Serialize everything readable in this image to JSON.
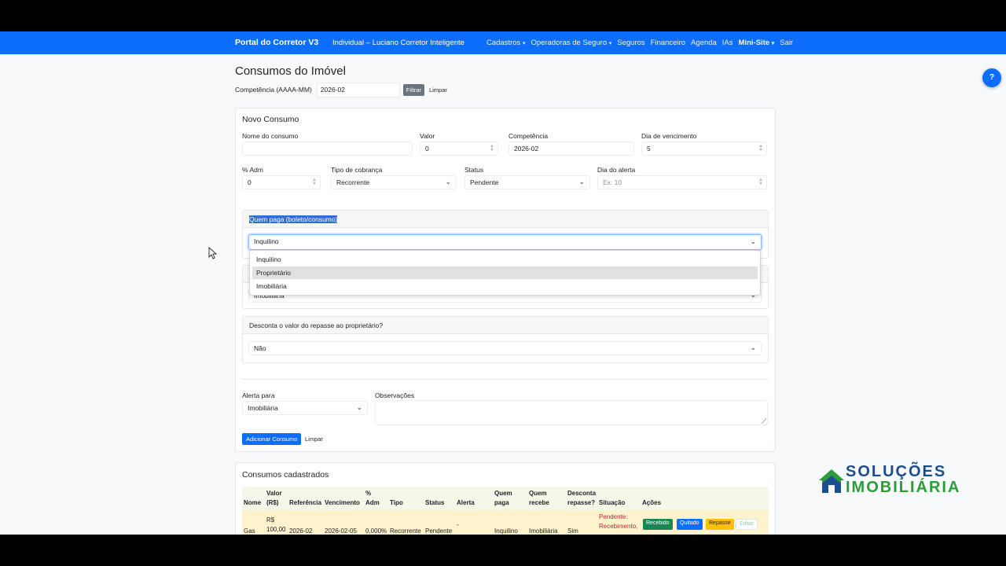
{
  "navbar": {
    "brand": "Portal do Corretor V3",
    "user": "Individual – Luciano Corretor Inteligente",
    "menu": {
      "cadastros": "Cadastros",
      "operadoras": "Operadoras de Seguro",
      "seguros": "Seguros",
      "financeiro": "Financeiro",
      "agenda": "Agenda",
      "ias": "IAs",
      "minisite": "Mini-Site",
      "sair": "Sair"
    }
  },
  "page": {
    "title": "Consumos do Imóvel",
    "filter_label": "Competência (AAAA-MM)",
    "filter_value": "2026-02",
    "filter_button": "Filtrar",
    "clear_button": "Limpar"
  },
  "form": {
    "title": "Novo Consumo",
    "nome_label": "Nome do consumo",
    "nome_value": "",
    "valor_label": "Valor",
    "valor_value": "0",
    "competencia_label": "Competência",
    "competencia_value": "2026-02",
    "dia_venc_label": "Dia de vencimento",
    "dia_venc_value": "5",
    "adm_label": "% Adm",
    "adm_value": "0",
    "tipo_label": "Tipo de cobrança",
    "tipo_value": "Recorrente",
    "status_label": "Status",
    "status_value": "Pendente",
    "dia_alerta_label": "Dia do alerta",
    "dia_alerta_placeholder": "Ex: 10",
    "quem_paga_label": "Quem paga (boleto/consumo)",
    "quem_paga_value": "Inquilino",
    "quem_paga_options": [
      "Inquilino",
      "Proprietário",
      "Imobiliária"
    ],
    "quem_recebe_value": "Imobiliária",
    "desconta_label": "Desconta o valor do repasse ao proprietário?",
    "desconta_value": "Não",
    "alerta_label": "Alerta para",
    "alerta_value": "Imobiliária",
    "obs_label": "Observações",
    "add_button": "Adicionar Consumo",
    "clear_button": "Limpar"
  },
  "list": {
    "title": "Consumos cadastrados",
    "headers": {
      "nome": "Nome",
      "valor_1": "Valor",
      "valor_2": "(R$)",
      "referencia": "Referência",
      "vencimento": "Vencimento",
      "adm_1": "%",
      "adm_2": "Adm",
      "tipo": "Tipo",
      "status": "Status",
      "alerta": "Alerta",
      "quem_paga_1": "Quem",
      "quem_paga_2": "paga",
      "quem_recebe_1": "Quem",
      "quem_recebe_2": "recebe",
      "desconta_1": "Desconta",
      "desconta_2": "repasse?",
      "situacao": "Situação",
      "acoes": "Ações"
    },
    "rows": [
      {
        "nome": "Gas",
        "valor_1": "R$",
        "valor_2": "100,00",
        "referencia": "2026-02",
        "vencimento": "2026-02-05",
        "adm": "0,000%",
        "tipo": "Recorrente",
        "status": "Pendente",
        "alerta": "-",
        "quem_paga": "Inquilino",
        "quem_recebe": "Imobiliária",
        "desconta": "Sim",
        "situacao": "Pendente: Recebimento,",
        "btn_recebido": "Recebido",
        "btn_quitado": "Quitado",
        "btn_repasse": "Repasse",
        "btn_editar": "Editar"
      }
    ]
  },
  "help_button": "?",
  "logo": {
    "line1": "SOLUÇÕES",
    "line2": "IMOBILIÁRIA"
  },
  "colors": {
    "primary": "#0d6efd",
    "success": "#198754",
    "warning": "#ffc107",
    "highlight": "#2e6fd1"
  }
}
